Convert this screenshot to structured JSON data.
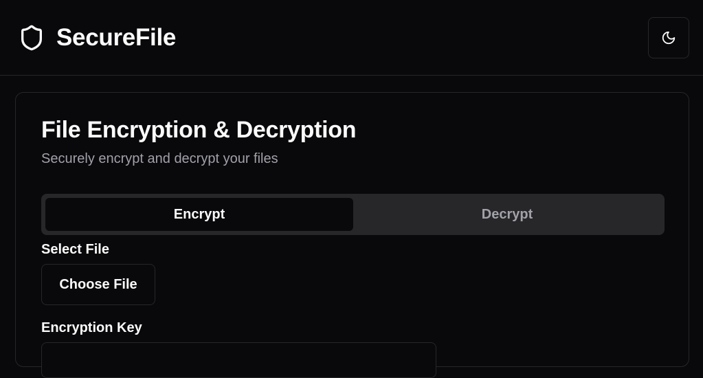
{
  "app": {
    "name": "SecureFile",
    "logo_icon": "shield-icon"
  },
  "header": {
    "theme_toggle_icon": "moon-icon"
  },
  "card": {
    "title": "File Encryption & Decryption",
    "subtitle": "Securely encrypt and decrypt your files"
  },
  "tabs": [
    {
      "label": "Encrypt",
      "active": true
    },
    {
      "label": "Decrypt",
      "active": false
    }
  ],
  "file": {
    "label": "Select File",
    "button_label": "Choose File"
  },
  "key": {
    "label": "Encryption Key",
    "value": ""
  },
  "colors": {
    "background": "#09090b",
    "border": "#27272a",
    "text": "#fafafa",
    "muted_text": "#a1a1aa",
    "tab_track": "#27272a"
  }
}
